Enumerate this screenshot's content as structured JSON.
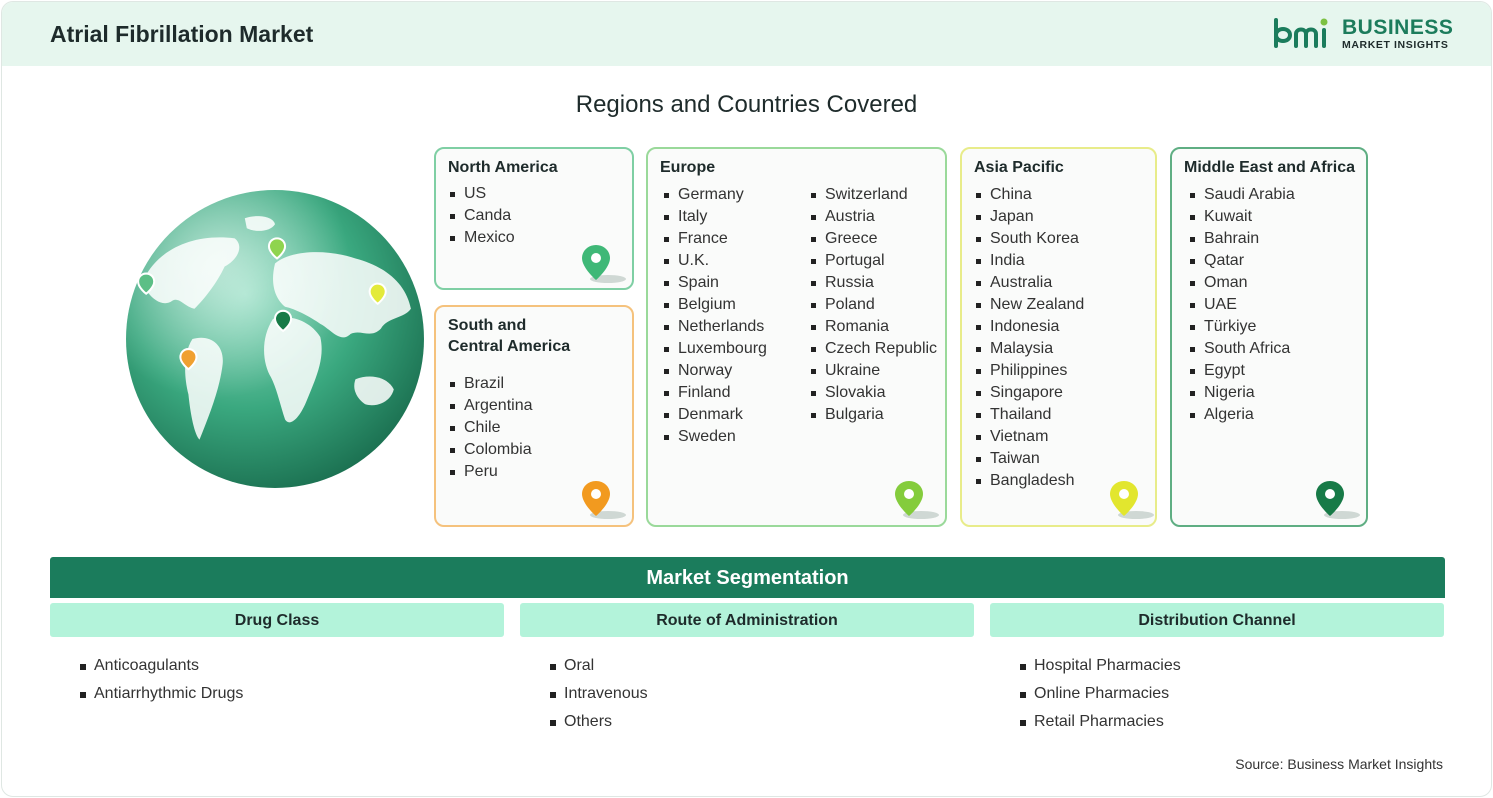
{
  "header": {
    "title": "Atrial Fibrillation Market"
  },
  "logo": {
    "line1": "BUSINESS",
    "line2": "MARKET INSIGHTS"
  },
  "regions_title": "Regions and Countries Covered",
  "regions": {
    "north_america": {
      "title": "North America",
      "countries": [
        "US",
        "Canda",
        "Mexico"
      ]
    },
    "south_central_america": {
      "title_line1": "South and",
      "title_line2": "Central America",
      "countries": [
        "Brazil",
        "Argentina",
        "Chile",
        "Colombia",
        "Peru"
      ]
    },
    "europe": {
      "title": "Europe",
      "col1": [
        "Germany",
        "Italy",
        "France",
        "U.K.",
        "Spain",
        "Belgium",
        "Netherlands",
        "Luxembourg",
        "Norway",
        "Finland",
        "Denmark",
        "Sweden"
      ],
      "col2": [
        "Switzerland",
        "Austria",
        "Greece",
        "Portugal",
        "Russia",
        "Poland",
        "Romania",
        "Czech Republic",
        "Ukraine",
        "Slovakia",
        "Bulgaria"
      ]
    },
    "asia_pacific": {
      "title": "Asia Pacific",
      "countries": [
        "China",
        "Japan",
        "South Korea",
        "India",
        "Australia",
        "New Zealand",
        "Indonesia",
        "Malaysia",
        "Philippines",
        "Singapore",
        "Thailand",
        "Vietnam",
        "Taiwan",
        "Bangladesh"
      ]
    },
    "middle_east_africa": {
      "title": "Middle East and Africa",
      "countries": [
        "Saudi Arabia",
        "Kuwait",
        "Bahrain",
        "Qatar",
        "Oman",
        "UAE",
        "Türkiye",
        "South Africa",
        "Egypt",
        "Nigeria",
        "Algeria"
      ]
    }
  },
  "colors": {
    "north_america": "#6dc59a",
    "south_central_america": "#f5b968",
    "europe": "#8fd48a",
    "asia_pacific": "#e9ec7a",
    "middle_east_africa": "#3f9d6d",
    "accent": "#1b7c5c"
  },
  "segmentation": {
    "title": "Market Segmentation",
    "drug_class": {
      "title": "Drug Class",
      "items": [
        "Anticoagulants",
        "Antiarrhythmic Drugs"
      ]
    },
    "route": {
      "title": "Route of Administration",
      "items": [
        "Oral",
        "Intravenous",
        "Others"
      ]
    },
    "distribution": {
      "title": "Distribution Channel",
      "items": [
        "Hospital Pharmacies",
        "Online Pharmacies",
        "Retail Pharmacies"
      ]
    }
  },
  "source": "Source: Business Market Insights",
  "icons": [
    "globe-icon",
    "map-pin-icon",
    "bmi-logo-icon"
  ]
}
